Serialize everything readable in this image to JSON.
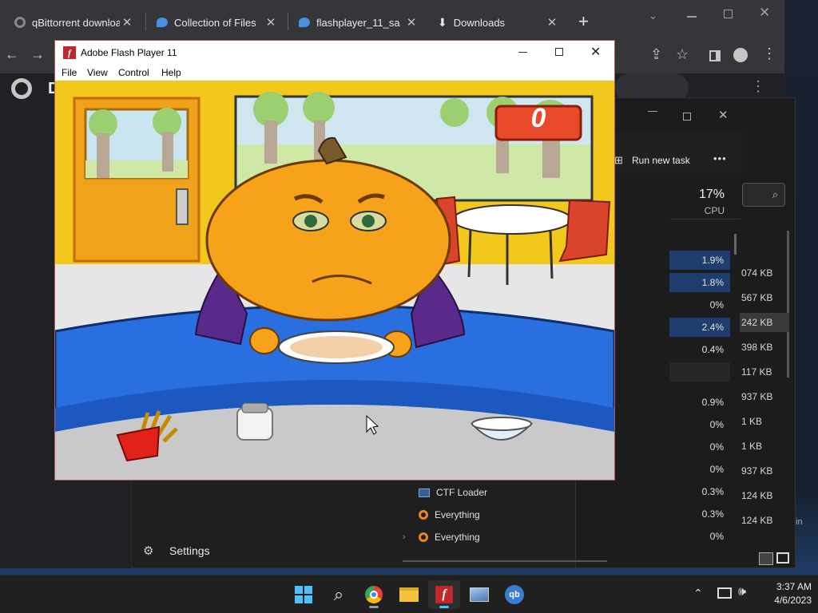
{
  "chrome": {
    "tabs": [
      {
        "title": "qBittorrent download"
      },
      {
        "title": "Collection of Files"
      },
      {
        "title": "flashplayer_11_sa"
      },
      {
        "title": "Downloads"
      }
    ],
    "new_tab": "+"
  },
  "flash_window": {
    "title": "Adobe Flash Player 11",
    "menu": [
      "File",
      "View",
      "Control",
      "Help"
    ],
    "score": "0"
  },
  "task_manager": {
    "run_new_task": "Run new task",
    "more": "•••",
    "cpu_percent": "17%",
    "cpu_label": "CPU",
    "cpu_values": [
      "1.9%",
      "1.8%",
      "0%",
      "2.4%",
      "0.4%",
      "",
      "0.9%",
      "0%",
      "0%",
      "0%",
      "0.3%",
      "0.3%",
      "0%"
    ],
    "cpu_highlight": [
      true,
      true,
      false,
      true,
      false,
      false,
      false,
      false,
      false,
      false,
      false,
      false,
      false
    ],
    "mem_values": [
      "074 KB",
      "567 KB",
      "242 KB",
      "398 KB",
      "117 KB",
      "937 KB",
      "1 KB",
      "1 KB",
      "937 KB",
      "124 KB",
      "124 KB"
    ],
    "processes": [
      {
        "name": "CTF Loader",
        "icon": "ctf-loader-icon"
      },
      {
        "name": "Everything",
        "icon": "search-icon"
      },
      {
        "name": "Everything",
        "icon": "search-icon",
        "expandable": true
      }
    ],
    "side_text": "in"
  },
  "settings_panel": {
    "settings_label": "Settings"
  },
  "taskbar": {
    "time": "3:37 AM",
    "date": "4/6/2023",
    "apps": [
      "start",
      "search",
      "chrome",
      "file-explorer",
      "flash-player",
      "image-viewer",
      "qbittorrent"
    ]
  },
  "colors": {
    "chrome_frame": "#35363a",
    "score_badge": "#e84a2a",
    "pumpkin": "#f7a21b",
    "table_blue": "#2a6fe0",
    "wall_yellow": "#f2c81c"
  }
}
